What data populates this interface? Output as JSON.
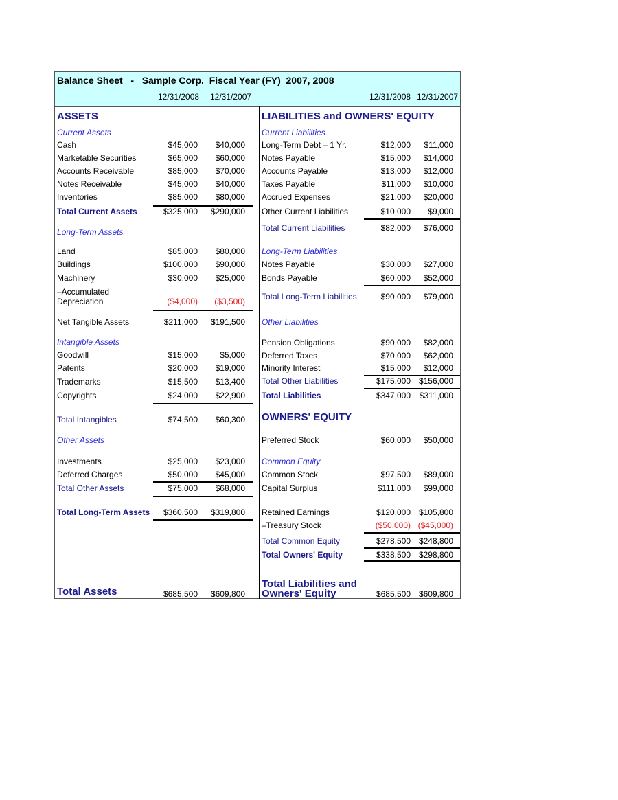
{
  "title": "Balance Sheet   -   Sample Corp.  Fiscal Year (FY)  2007, 2008",
  "dates": {
    "col1": "12/31/2008",
    "col2": "12/31/2007"
  },
  "assets": {
    "heading": "ASSETS",
    "current_heading": "Current Assets",
    "current": [
      {
        "label": "Cash",
        "v2008": "$45,000",
        "v2007": "$40,000"
      },
      {
        "label": "Marketable Securities",
        "v2008": "$65,000",
        "v2007": "$60,000"
      },
      {
        "label": "Accounts Receivable",
        "v2008": "$85,000",
        "v2007": "$70,000"
      },
      {
        "label": "Notes Receivable",
        "v2008": "$45,000",
        "v2007": "$40,000"
      },
      {
        "label": "Inventories",
        "v2008": "$85,000",
        "v2007": "$80,000"
      }
    ],
    "total_current": {
      "label": "Total Current Assets",
      "v2008": "$325,000",
      "v2007": "$290,000"
    },
    "longterm_heading": "Long-Term Assets",
    "longterm": [
      {
        "label": "Land",
        "v2008": "$85,000",
        "v2007": "$80,000"
      },
      {
        "label": "Buildings",
        "v2008": "$100,000",
        "v2007": "$90,000"
      },
      {
        "label": "Machinery",
        "v2008": "$30,000",
        "v2007": "$25,000"
      }
    ],
    "accum_dep": {
      "label1": "–Accumulated",
      "label2": "Depreciation",
      "v2008": "($4,000)",
      "v2007": "($3,500)"
    },
    "net_tangible": {
      "label": "Net Tangible Assets",
      "v2008": "$211,000",
      "v2007": "$191,500"
    },
    "intangible_heading": "Intangible Assets",
    "intangible": [
      {
        "label": "Goodwill",
        "v2008": "$15,000",
        "v2007": "$5,000"
      },
      {
        "label": "Patents",
        "v2008": "$20,000",
        "v2007": "$19,000"
      },
      {
        "label": "Trademarks",
        "v2008": "$15,500",
        "v2007": "$13,400"
      },
      {
        "label": "Copyrights",
        "v2008": "$24,000",
        "v2007": "$22,900"
      }
    ],
    "total_intangibles": {
      "label": "Total Intangibles",
      "v2008": "$74,500",
      "v2007": "$60,300"
    },
    "other_heading": "Other Assets",
    "other": [
      {
        "label": "Investments",
        "v2008": "$25,000",
        "v2007": "$23,000"
      },
      {
        "label": "Deferred Charges",
        "v2008": "$50,000",
        "v2007": "$45,000"
      }
    ],
    "total_other": {
      "label": "Total Other Assets",
      "v2008": "$75,000",
      "v2007": "$68,000"
    },
    "total_longterm": {
      "label": "Total Long-Term Assets",
      "v2008": "$360,500",
      "v2007": "$319,800"
    },
    "total_assets": {
      "label": "Total Assets",
      "v2008": "$685,500",
      "v2007": "$609,800"
    }
  },
  "liabilities": {
    "heading": "LIABILITIES and OWNERS' EQUITY",
    "current_heading": "Current Liabilities",
    "current": [
      {
        "label": "Long-Term Debt – 1 Yr.",
        "v2008": "$12,000",
        "v2007": "$11,000"
      },
      {
        "label": "Notes Payable",
        "v2008": "$15,000",
        "v2007": "$14,000"
      },
      {
        "label": "Accounts Payable",
        "v2008": "$13,000",
        "v2007": "$12,000"
      },
      {
        "label": "Taxes Payable",
        "v2008": "$11,000",
        "v2007": "$10,000"
      },
      {
        "label": "Accrued Expenses",
        "v2008": "$21,000",
        "v2007": "$20,000"
      },
      {
        "label": "Other Current Liabilities",
        "v2008": "$10,000",
        "v2007": "$9,000"
      }
    ],
    "total_current": {
      "label": "Total Current Liabilities",
      "v2008": "$82,000",
      "v2007": "$76,000"
    },
    "longterm_heading": "Long-Term Liabilities",
    "longterm": [
      {
        "label": "Notes Payable",
        "v2008": "$30,000",
        "v2007": "$27,000"
      },
      {
        "label": "Bonds Payable",
        "v2008": "$60,000",
        "v2007": "$52,000"
      }
    ],
    "total_longterm": {
      "label": "Total Long-Term Liabilities",
      "v2008": "$90,000",
      "v2007": "$79,000"
    },
    "other_heading": "Other Liabilities",
    "other": [
      {
        "label": "Pension Obligations",
        "v2008": "$90,000",
        "v2007": "$82,000"
      },
      {
        "label": "Deferred Taxes",
        "v2008": "$70,000",
        "v2007": "$62,000"
      },
      {
        "label": "Minority Interest",
        "v2008": "$15,000",
        "v2007": "$12,000"
      }
    ],
    "total_other": {
      "label": "Total Other Liabilities",
      "v2008": "$175,000",
      "v2007": "$156,000"
    },
    "total_liabilities": {
      "label": "Total Liabilities",
      "v2008": "$347,000",
      "v2007": "$311,000"
    }
  },
  "equity": {
    "heading": "OWNERS' EQUITY",
    "preferred": {
      "label": "Preferred Stock",
      "v2008": "$60,000",
      "v2007": "$50,000"
    },
    "common_heading": "Common Equity",
    "common_stock": {
      "label": "Common Stock",
      "v2008": "$97,500",
      "v2007": "$89,000"
    },
    "capital_surplus": {
      "label": "Capital Surplus",
      "v2008": "$111,000",
      "v2007": "$99,000"
    },
    "retained": {
      "label": "Retained Earnings",
      "v2008": "$120,000",
      "v2007": "$105,800"
    },
    "treasury": {
      "label": "–Treasury Stock",
      "v2008": "($50,000)",
      "v2007": "($45,000)"
    },
    "total_common": {
      "label": "Total Common Equity",
      "v2008": "$278,500",
      "v2007": "$248,800"
    },
    "total_owners": {
      "label": "Total Owners' Equity",
      "v2008": "$338,500",
      "v2007": "$298,800"
    },
    "total_liab_equity": {
      "label1": "Total Liabilities and",
      "label2": "Owners' Equity",
      "v2008": "$685,500",
      "v2007": "$609,800"
    }
  },
  "colors": {
    "header_bg": "#ccffff",
    "section": "#2b2bd9",
    "total": "#1a1a8c",
    "negative": "#e02020"
  }
}
